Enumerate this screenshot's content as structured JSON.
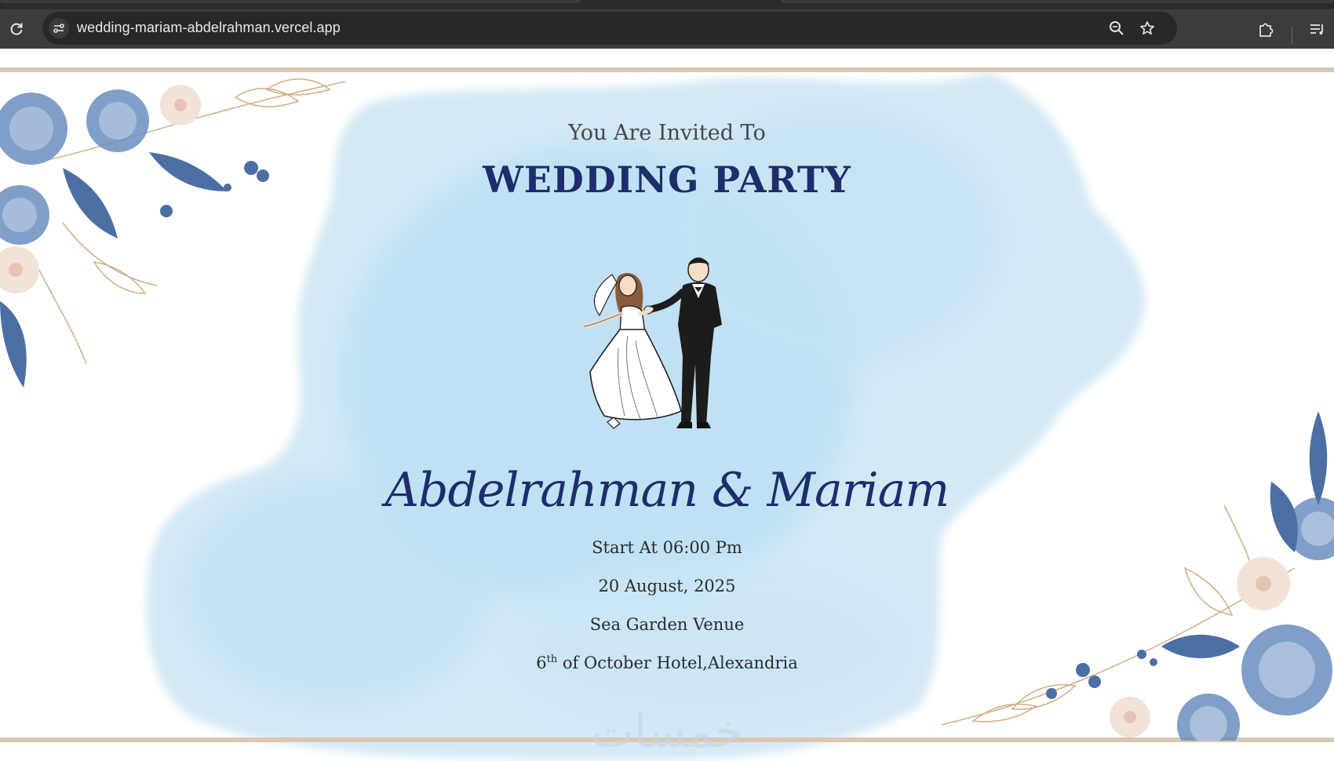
{
  "browser": {
    "url": "wedding-mariam-abdelrahman.vercel.app",
    "icons": [
      "reload-icon",
      "site-info-icon",
      "zoom-icon",
      "bookmark-star-icon",
      "extensions-icon",
      "reading-list-icon"
    ]
  },
  "invitation": {
    "intro": "You Are Invited To",
    "title": "WEDDING PARTY",
    "names": "Abdelrahman & Mariam",
    "time": "Start At 06:00 Pm",
    "date": "20 August, 2025",
    "venue": "Sea Garden Venue",
    "location_ordinal": "6",
    "location_suffix": "th",
    "location_rest": " of October Hotel,Alexandria",
    "watermark": "خمسات"
  },
  "colors": {
    "title": "#1e2d6b",
    "wash": "#cfe6f5",
    "border": "#dcc6b0",
    "flower": "#6b8fbf"
  }
}
